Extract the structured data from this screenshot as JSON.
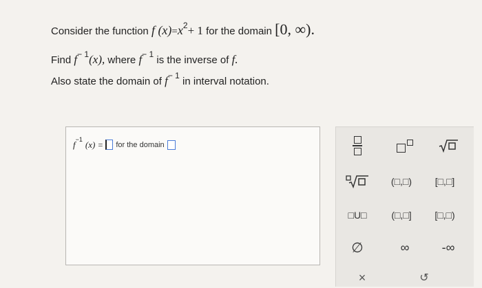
{
  "question": {
    "line1_prefix": "Consider the function",
    "function_lhs": "f (x)",
    "equals": "=",
    "function_base": "x",
    "function_exponent": "2",
    "function_tail": "+ 1",
    "domain_text": "for the domain",
    "domain_interval": "[0, ∞).",
    "line2_find": "Find",
    "finv_f": "f",
    "finv_exp": "− 1",
    "finv_arg": "(x),",
    "line2_where": "where",
    "line2_inverse_of": "is the inverse of",
    "f_period": "f.",
    "line3_text": "Also state the domain of",
    "line3_tail": "in interval notation."
  },
  "answer": {
    "f": "f",
    "exp": "−1",
    "arg": "(x)",
    "equals": "=",
    "domain_label": "for the domain"
  },
  "keypad": {
    "interval_open_open": "(□,□)",
    "interval_closed_closed": "[□,□]",
    "interval_closed_open": "[□,□)",
    "interval_open_closed": "(□,□]",
    "union": "□U□",
    "infinity": "∞",
    "neg_infinity": "-∞",
    "empty_set": "∅",
    "clear": "×",
    "undo": "↺"
  }
}
